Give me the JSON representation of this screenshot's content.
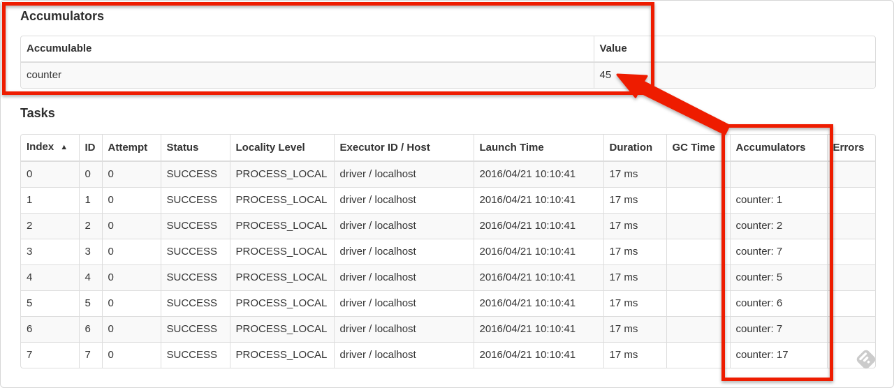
{
  "colors": {
    "annotation_red": "#ee1c00",
    "watermark_gray": "#c9c9c9",
    "table_border": "#dddddd",
    "row_stripe": "#f9f9f9",
    "text": "#333333"
  },
  "accumulators_section": {
    "title": "Accumulators",
    "table": {
      "headers": [
        "Accumulable",
        "Value"
      ],
      "rows": [
        {
          "accumulable": "counter",
          "value": "45"
        }
      ]
    }
  },
  "tasks_section": {
    "title": "Tasks",
    "table": {
      "sort_indicator": "▲",
      "headers": [
        "Index",
        "ID",
        "Attempt",
        "Status",
        "Locality Level",
        "Executor ID / Host",
        "Launch Time",
        "Duration",
        "GC Time",
        "Accumulators",
        "Errors"
      ],
      "rows": [
        {
          "index": "0",
          "id": "0",
          "attempt": "0",
          "status": "SUCCESS",
          "locality_level": "PROCESS_LOCAL",
          "executor_id_host": "driver / localhost",
          "launch_time": "2016/04/21 10:10:41",
          "duration": "17 ms",
          "gc_time": "",
          "accumulators": "",
          "errors": ""
        },
        {
          "index": "1",
          "id": "1",
          "attempt": "0",
          "status": "SUCCESS",
          "locality_level": "PROCESS_LOCAL",
          "executor_id_host": "driver / localhost",
          "launch_time": "2016/04/21 10:10:41",
          "duration": "17 ms",
          "gc_time": "",
          "accumulators": "counter: 1",
          "errors": ""
        },
        {
          "index": "2",
          "id": "2",
          "attempt": "0",
          "status": "SUCCESS",
          "locality_level": "PROCESS_LOCAL",
          "executor_id_host": "driver / localhost",
          "launch_time": "2016/04/21 10:10:41",
          "duration": "17 ms",
          "gc_time": "",
          "accumulators": "counter: 2",
          "errors": ""
        },
        {
          "index": "3",
          "id": "3",
          "attempt": "0",
          "status": "SUCCESS",
          "locality_level": "PROCESS_LOCAL",
          "executor_id_host": "driver / localhost",
          "launch_time": "2016/04/21 10:10:41",
          "duration": "17 ms",
          "gc_time": "",
          "accumulators": "counter: 7",
          "errors": ""
        },
        {
          "index": "4",
          "id": "4",
          "attempt": "0",
          "status": "SUCCESS",
          "locality_level": "PROCESS_LOCAL",
          "executor_id_host": "driver / localhost",
          "launch_time": "2016/04/21 10:10:41",
          "duration": "17 ms",
          "gc_time": "",
          "accumulators": "counter: 5",
          "errors": ""
        },
        {
          "index": "5",
          "id": "5",
          "attempt": "0",
          "status": "SUCCESS",
          "locality_level": "PROCESS_LOCAL",
          "executor_id_host": "driver / localhost",
          "launch_time": "2016/04/21 10:10:41",
          "duration": "17 ms",
          "gc_time": "",
          "accumulators": "counter: 6",
          "errors": ""
        },
        {
          "index": "6",
          "id": "6",
          "attempt": "0",
          "status": "SUCCESS",
          "locality_level": "PROCESS_LOCAL",
          "executor_id_host": "driver / localhost",
          "launch_time": "2016/04/21 10:10:41",
          "duration": "17 ms",
          "gc_time": "",
          "accumulators": "counter: 7",
          "errors": ""
        },
        {
          "index": "7",
          "id": "7",
          "attempt": "0",
          "status": "SUCCESS",
          "locality_level": "PROCESS_LOCAL",
          "executor_id_host": "driver / localhost",
          "launch_time": "2016/04/21 10:10:41",
          "duration": "17 ms",
          "gc_time": "",
          "accumulators": "counter: 17",
          "errors": ""
        }
      ]
    }
  }
}
